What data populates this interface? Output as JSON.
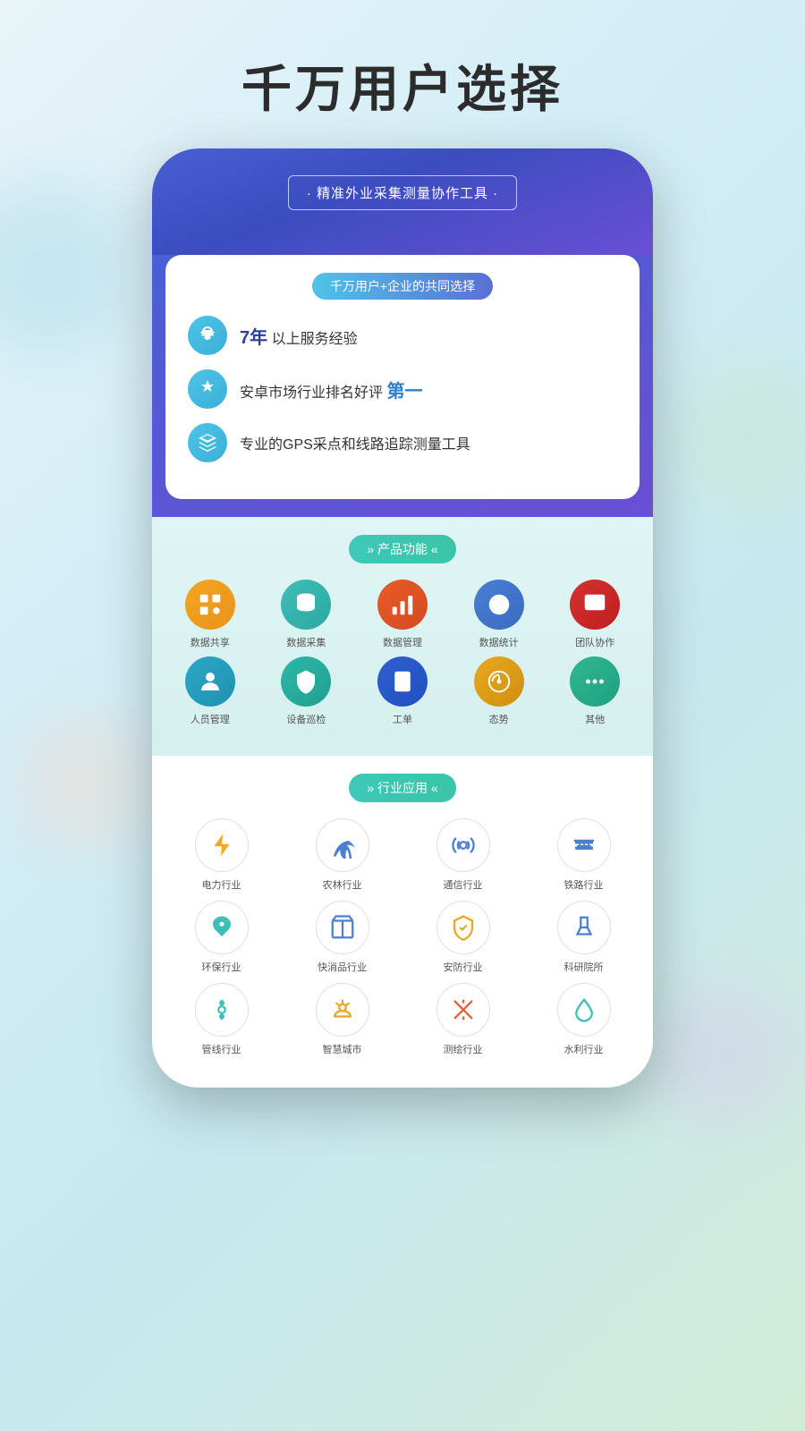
{
  "page": {
    "title": "千万用户选择",
    "bg_colors": [
      "#e8f4f8",
      "#d4eef7"
    ]
  },
  "banner": {
    "tag_text": "· 精准外业采集测量协作工具 ·"
  },
  "card": {
    "subtitle": "千万用户+企业的共同选择",
    "features": [
      {
        "icon": "trophy",
        "text_pre": "",
        "bold": "7年",
        "text_post": " 以上服务经验"
      },
      {
        "icon": "crown",
        "text_pre": "安卓市场行业排名好评 ",
        "bold": "第一",
        "text_post": ""
      },
      {
        "icon": "navigation",
        "text_pre": "专业的GPS采点和线路追踪测量工具",
        "bold": "",
        "text_post": ""
      }
    ]
  },
  "product_functions": {
    "section_title": "» 产品功能 «",
    "items": [
      {
        "label": "数据共享",
        "color": "orange",
        "icon": "share"
      },
      {
        "label": "数据采集",
        "color": "teal",
        "icon": "database"
      },
      {
        "label": "数据管理",
        "color": "red-orange",
        "icon": "bar-chart"
      },
      {
        "label": "数据统计",
        "color": "blue",
        "icon": "pie-chart"
      },
      {
        "label": "团队协作",
        "color": "red",
        "icon": "team"
      },
      {
        "label": "人员管理",
        "color": "teal-dark",
        "icon": "person"
      },
      {
        "label": "设备巡检",
        "color": "teal-green",
        "icon": "shield-search"
      },
      {
        "label": "工单",
        "color": "blue-dark",
        "icon": "clipboard"
      },
      {
        "label": "态势",
        "color": "amber",
        "icon": "gauge"
      },
      {
        "label": "其他",
        "color": "green-teal",
        "icon": "more"
      }
    ]
  },
  "industry_applications": {
    "section_title": "» 行业应用 «",
    "rows": [
      [
        {
          "label": "电力行业",
          "icon": "lightning",
          "color": "#f5a623"
        },
        {
          "label": "农林行业",
          "icon": "tree",
          "color": "#4a7fd4"
        },
        {
          "label": "通信行业",
          "icon": "signal",
          "color": "#4a7fd4"
        },
        {
          "label": "铁路行业",
          "icon": "rail",
          "color": "#4a7fd4"
        }
      ],
      [
        {
          "label": "环保行业",
          "icon": "leaf",
          "color": "#3dbfb8"
        },
        {
          "label": "快消品行业",
          "icon": "box",
          "color": "#4a7fd4"
        },
        {
          "label": "安防行业",
          "icon": "shield",
          "color": "#e8a820"
        },
        {
          "label": "科研院所",
          "icon": "flask",
          "color": "#4a7fd4"
        }
      ],
      [
        {
          "label": "管线行业",
          "icon": "pipe",
          "color": "#3dbfb8"
        },
        {
          "label": "智慧城市",
          "icon": "bulb",
          "color": "#e8a820"
        },
        {
          "label": "测绘行业",
          "icon": "tools",
          "color": "#e85c2c"
        },
        {
          "label": "水利行业",
          "icon": "water",
          "color": "#3dbfb8"
        }
      ]
    ]
  }
}
